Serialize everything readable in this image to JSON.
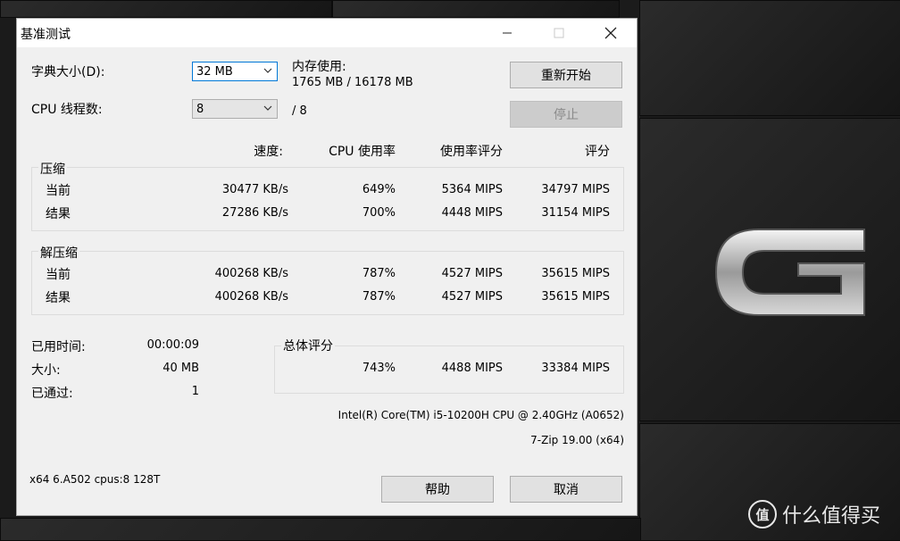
{
  "window": {
    "title": "基准测试"
  },
  "dictionary": {
    "label": "字典大小(D):",
    "value": "32 MB"
  },
  "threads": {
    "label": "CPU 线程数:",
    "value": "8",
    "max": "/ 8"
  },
  "memory": {
    "label": "内存使用:",
    "value": "1765 MB / 16178 MB"
  },
  "buttons": {
    "restart": "重新开始",
    "stop": "停止",
    "help": "帮助",
    "cancel": "取消"
  },
  "columns": {
    "speed": "速度:",
    "cpu_usage": "CPU 使用率",
    "usage_rating": "使用率评分",
    "rating": "评分"
  },
  "compress": {
    "title": "压缩",
    "current": {
      "label": "当前",
      "speed": "30477 KB/s",
      "usage": "649%",
      "usage_rating": "5364 MIPS",
      "rating": "34797 MIPS"
    },
    "result": {
      "label": "结果",
      "speed": "27286 KB/s",
      "usage": "700%",
      "usage_rating": "4448 MIPS",
      "rating": "31154 MIPS"
    }
  },
  "decompress": {
    "title": "解压缩",
    "current": {
      "label": "当前",
      "speed": "400268 KB/s",
      "usage": "787%",
      "usage_rating": "4527 MIPS",
      "rating": "35615 MIPS"
    },
    "result": {
      "label": "结果",
      "speed": "400268 KB/s",
      "usage": "787%",
      "usage_rating": "4527 MIPS",
      "rating": "35615 MIPS"
    }
  },
  "stats": {
    "elapsed_label": "已用时间:",
    "elapsed": "00:00:09",
    "size_label": "大小:",
    "size": "40 MB",
    "passes_label": "已通过:",
    "passes": "1"
  },
  "total": {
    "title": "总体评分",
    "usage": "743%",
    "usage_rating": "4488 MIPS",
    "rating": "33384 MIPS"
  },
  "cpu_info": "Intel(R) Core(TM) i5-10200H CPU @ 2.40GHz (A0652)",
  "version": "7-Zip 19.00 (x64)",
  "sysinfo": "x64 6.A502 cpus:8 128T",
  "watermark": {
    "logo": "值",
    "text": "什么值得买"
  }
}
